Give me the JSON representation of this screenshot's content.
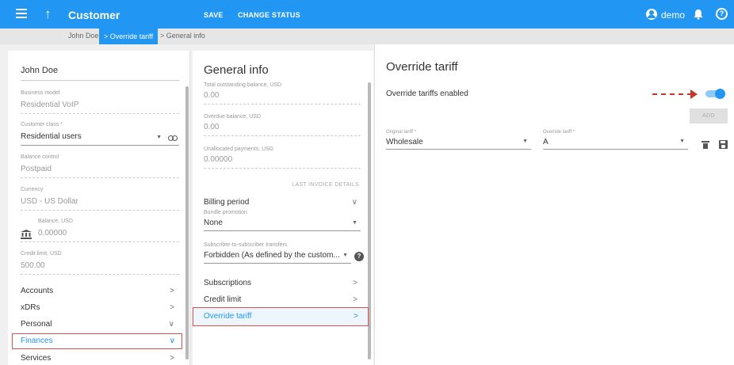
{
  "header": {
    "title": "Customer",
    "save_label": "SAVE",
    "change_status_label": "CHANGE STATUS",
    "user": "demo",
    "help_glyph": "?",
    "back_glyph": "↑"
  },
  "breadcrumb": {
    "items": [
      "John Doe",
      "Override tariff",
      "General info"
    ],
    "separator": ">"
  },
  "left": {
    "name": "John Doe",
    "fields": [
      {
        "label": "Business model",
        "value": "Residential VoIP"
      },
      {
        "label": "Customer class *",
        "value": "Residential users"
      },
      {
        "label": "Balance control",
        "value": "Postpaid"
      },
      {
        "label": "Currency",
        "value": "USD - US Dollar"
      },
      {
        "label": "Balance, USD",
        "value": "0.00000"
      },
      {
        "label": "Credit limit, USD",
        "value": "500.00"
      }
    ],
    "nav": [
      "Accounts",
      "xDRs",
      "Personal",
      "Finances",
      "Services"
    ],
    "chev_right": ">",
    "chev_down": "∨"
  },
  "middle": {
    "title": "General info",
    "fields": [
      {
        "label": "Total outstanding balance, USD",
        "value": "0.00"
      },
      {
        "label": "Overdue balance, USD",
        "value": "0.00"
      },
      {
        "label": "Unallocated payments, USD",
        "value": "0.00000"
      }
    ],
    "last_invoice": "LAST INVOICE DETAILS",
    "billing_period": "Billing period",
    "bundle": {
      "label": "Bundle promotion",
      "value": "None"
    },
    "transfers": {
      "label": "Subscriber-to-subscriber transfers",
      "value": "Forbidden (As defined by the custom..."
    },
    "nav": [
      "Subscriptions",
      "Credit limit",
      "Override tariff"
    ],
    "help_glyph": "?"
  },
  "right": {
    "title": "Override tariff",
    "enabled_label": "Override tariffs enabled",
    "enabled": true,
    "add_label": "ADD",
    "original": {
      "label": "Original tariff *",
      "value": "Wholesale"
    },
    "override": {
      "label": "Override tariff *",
      "value": "A"
    }
  },
  "colors": {
    "accent": "#2196f3",
    "highlight": "#d9534f"
  }
}
